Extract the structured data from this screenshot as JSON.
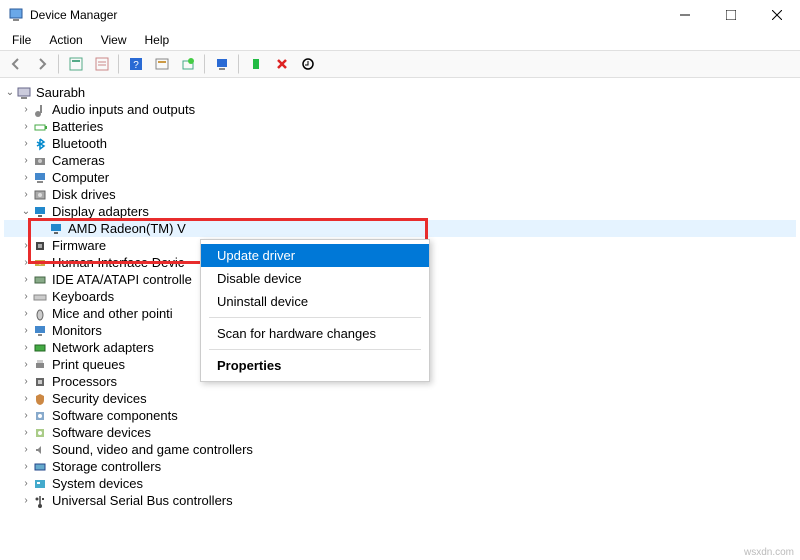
{
  "window": {
    "title": "Device Manager"
  },
  "menus": {
    "file": "File",
    "action": "Action",
    "view": "View",
    "help": "Help"
  },
  "root": {
    "label": "Saurabh"
  },
  "categories": [
    {
      "label": "Audio inputs and outputs",
      "icon": "audio"
    },
    {
      "label": "Batteries",
      "icon": "battery"
    },
    {
      "label": "Bluetooth",
      "icon": "bluetooth"
    },
    {
      "label": "Cameras",
      "icon": "camera"
    },
    {
      "label": "Computer",
      "icon": "computer"
    },
    {
      "label": "Disk drives",
      "icon": "disk"
    },
    {
      "label": "Display adapters",
      "icon": "display",
      "expanded": true
    },
    {
      "label": "Firmware",
      "icon": "firmware"
    },
    {
      "label": "Human Interface Devic",
      "icon": "hid"
    },
    {
      "label": "IDE ATA/ATAPI controlle",
      "icon": "ide"
    },
    {
      "label": "Keyboards",
      "icon": "keyboard"
    },
    {
      "label": "Mice and other pointi",
      "icon": "mouse"
    },
    {
      "label": "Monitors",
      "icon": "monitor"
    },
    {
      "label": "Network adapters",
      "icon": "network"
    },
    {
      "label": "Print queues",
      "icon": "printer"
    },
    {
      "label": "Processors",
      "icon": "cpu"
    },
    {
      "label": "Security devices",
      "icon": "security"
    },
    {
      "label": "Software components",
      "icon": "swcomp"
    },
    {
      "label": "Software devices",
      "icon": "swdev"
    },
    {
      "label": "Sound, video and game controllers",
      "icon": "sound"
    },
    {
      "label": "Storage controllers",
      "icon": "storage"
    },
    {
      "label": "System devices",
      "icon": "system"
    },
    {
      "label": "Universal Serial Bus controllers",
      "icon": "usb"
    }
  ],
  "child_device": {
    "label": "AMD Radeon(TM) V"
  },
  "context_menu": {
    "items": [
      {
        "label": "Update driver",
        "highlighted": true
      },
      {
        "label": "Disable device"
      },
      {
        "label": "Uninstall device"
      }
    ],
    "scan": "Scan for hardware changes",
    "props": "Properties"
  },
  "watermark": "wsxdn.com"
}
